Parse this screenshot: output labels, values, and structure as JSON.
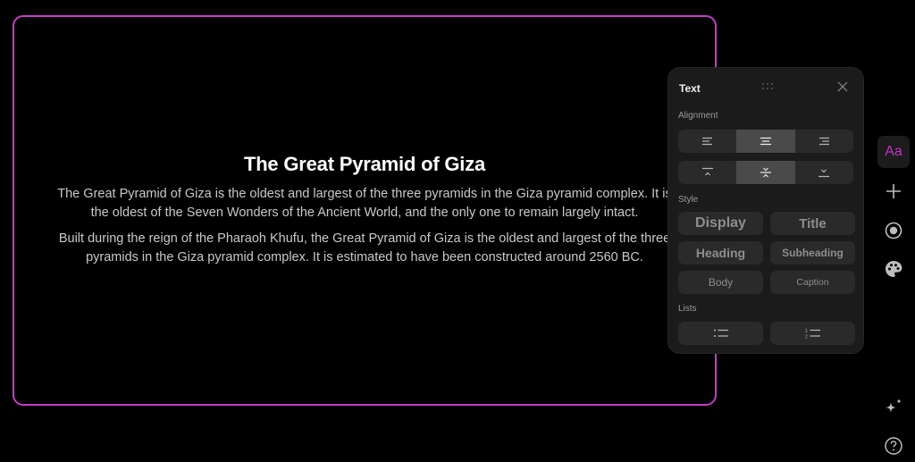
{
  "slide": {
    "title": "The Great Pyramid of Giza",
    "paragraphs": [
      "The Great Pyramid of Giza is the oldest and largest of the three pyramids in the Giza pyramid complex. It is the oldest of the Seven Wonders of the Ancient World, and the only one to remain largely intact.",
      "Built during the reign of the Pharaoh Khufu, the Great Pyramid of Giza is the oldest and largest of the three pyramids in the Giza pyramid complex. It is estimated to have been constructed around 2560 BC."
    ],
    "border_color": "#c43fc6"
  },
  "panel": {
    "title": "Text",
    "alignment_label": "Alignment",
    "horizontal_alignment": [
      "left",
      "center",
      "right"
    ],
    "horizontal_selected": "center",
    "vertical_alignment": [
      "top",
      "middle",
      "bottom"
    ],
    "vertical_selected": "middle",
    "style_label": "Style",
    "styles": [
      "Display",
      "Title",
      "Heading",
      "Subheading",
      "Body",
      "Caption"
    ],
    "lists_label": "Lists",
    "lists": [
      "bulleted-list",
      "numbered-list"
    ]
  },
  "rail": {
    "text_tool_label": "Aa",
    "accent_color": "#c032c4",
    "items": [
      "text-icon",
      "plus-icon",
      "record-icon",
      "palette-icon",
      "sparkle-icon",
      "help-icon"
    ]
  }
}
